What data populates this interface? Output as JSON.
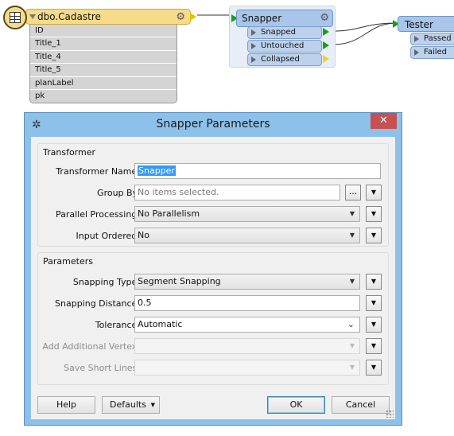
{
  "canvas": {
    "reader": {
      "title": "dbo.Cadastre",
      "attributes": [
        "ID",
        "Title_1",
        "Title_4",
        "Title_5",
        "planLabel",
        "pk"
      ]
    },
    "snapper": {
      "title": "Snapper",
      "ports": [
        "Snapped",
        "Untouched",
        "Collapsed"
      ]
    },
    "tester": {
      "title": "Tester",
      "ports": [
        "Passed",
        "Failed"
      ]
    }
  },
  "dialog": {
    "title": "Snapper Parameters",
    "close_label": "✕",
    "transformer_group": {
      "title": "Transformer",
      "name_label": "Transformer Name:",
      "name_value": "Snapper",
      "group_by_label": "Group By:",
      "group_by_placeholder": "No items selected.",
      "ellipsis_label": "...",
      "parallel_label": "Parallel Processing:",
      "parallel_value": "No Parallelism",
      "input_ordered_label": "Input Ordered:",
      "input_ordered_value": "No"
    },
    "parameters_group": {
      "title": "Parameters",
      "snapping_type_label": "Snapping Type:",
      "snapping_type_value": "Segment Snapping",
      "snapping_distance_label": "Snapping Distance:",
      "snapping_distance_value": "0.5",
      "tolerance_label": "Tolerance:",
      "tolerance_value": "Automatic",
      "add_vertex_label": "Add Additional Vertex:",
      "add_vertex_value": "",
      "save_short_label": "Save Short Lines:",
      "save_short_value": ""
    },
    "buttons": {
      "help": "Help",
      "defaults": "Defaults",
      "ok": "OK",
      "cancel": "Cancel"
    }
  },
  "colors": {
    "reader_fill": "#f6dc8a",
    "transformer_fill": "#a9c6ea",
    "port_green": "#16a016",
    "port_yellow": "#f0d030",
    "dialog_frame": "#8ec1ea",
    "close_red": "#c75050"
  }
}
